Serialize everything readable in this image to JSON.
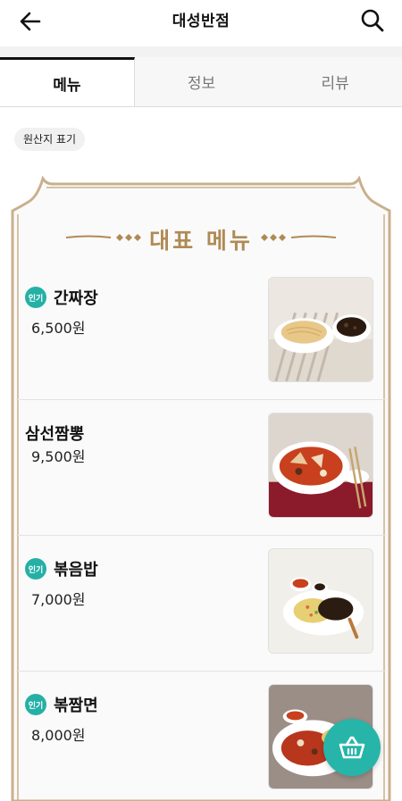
{
  "header": {
    "title": "대성반점"
  },
  "tabs": [
    {
      "label": "메뉴"
    },
    {
      "label": "정보"
    },
    {
      "label": "리뷰"
    }
  ],
  "origin_chip": "원산지 표기",
  "section_title": "대표 메뉴",
  "menu": [
    {
      "badge": "인기",
      "name": "간짜장",
      "price": "6,500원",
      "image": "jajangmyeon-photo"
    },
    {
      "badge": "",
      "name": "삼선짬뽕",
      "price": "9,500원",
      "image": "jjamppong-photo"
    },
    {
      "badge": "인기",
      "name": "볶음밥",
      "price": "7,000원",
      "image": "fried-rice-photo"
    },
    {
      "badge": "인기",
      "name": "볶짬면",
      "price": "8,000원",
      "image": "stir-fried-jjamppong-photo"
    }
  ],
  "colors": {
    "accent": "#27b4a9",
    "gold": "#b08a55"
  }
}
